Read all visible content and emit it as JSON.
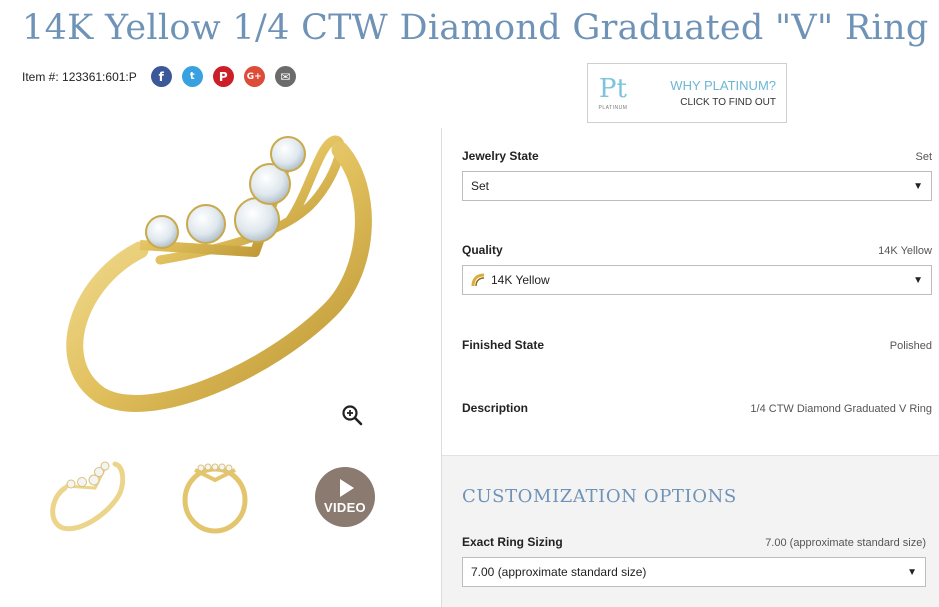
{
  "product": {
    "title": "14K Yellow 1/4 CTW Diamond Graduated \"V\" Ring",
    "item_label": "Item #: 123361:601:P"
  },
  "share": {
    "facebook_glyph": "f",
    "twitter_glyph": "t",
    "pinterest_glyph": "P",
    "googleplus_glyph": "G+",
    "email_glyph": "✉"
  },
  "promo": {
    "logo_mark": "Pt",
    "logo_text": "PLATINUM",
    "heading": "WHY PLATINUM?",
    "subheading": "CLICK TO FIND OUT",
    "accent_color": "#6cb7d4"
  },
  "media": {
    "video_label": "VIDEO",
    "icons": [
      "zoom-in-icon",
      "play-icon"
    ]
  },
  "options": {
    "jewelry_state": {
      "label": "Jewelry State",
      "value": "Set",
      "selected": "Set"
    },
    "quality": {
      "label": "Quality",
      "value": "14K Yellow",
      "selected": "14K Yellow"
    },
    "finished_state": {
      "label": "Finished State",
      "value": "Polished"
    },
    "description": {
      "label": "Description",
      "value": "1/4 CTW Diamond Graduated V Ring"
    }
  },
  "customization": {
    "title": "CUSTOMIZATION OPTIONS",
    "ring_sizing": {
      "label": "Exact Ring Sizing",
      "value": "7.00 (approximate standard size)",
      "selected": "7.00 (approximate standard size)"
    }
  },
  "colors": {
    "title_blue": "#6f93b7",
    "gold": "#e7c96a",
    "video_bg": "#8a7a70"
  }
}
